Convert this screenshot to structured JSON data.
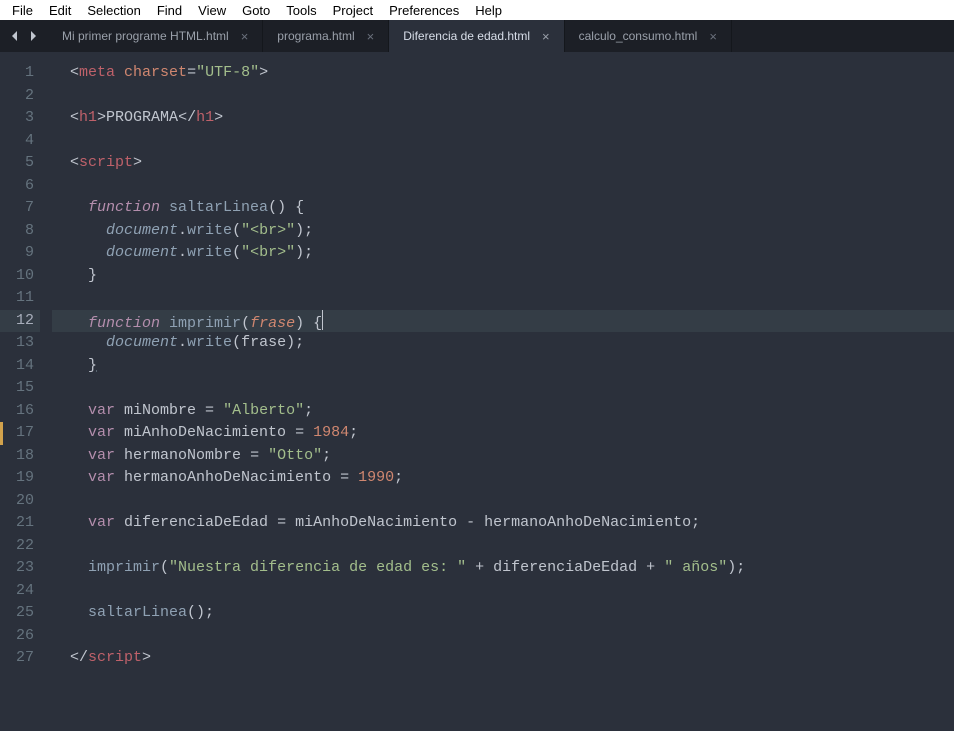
{
  "menu": {
    "items": [
      "File",
      "Edit",
      "Selection",
      "Find",
      "View",
      "Goto",
      "Tools",
      "Project",
      "Preferences",
      "Help"
    ]
  },
  "tabs": [
    {
      "label": "Mi primer programe HTML.html",
      "active": false
    },
    {
      "label": "programa.html",
      "active": false
    },
    {
      "label": "Diferencia de edad.html",
      "active": true
    },
    {
      "label": "calculo_consumo.html",
      "active": false
    }
  ],
  "current_line": 12,
  "modified_lines": [
    17
  ],
  "code": {
    "lines": [
      [
        {
          "t": "punct",
          "v": "<"
        },
        {
          "t": "tag",
          "v": "meta"
        },
        {
          "t": "plain",
          "v": " "
        },
        {
          "t": "attr",
          "v": "charset"
        },
        {
          "t": "punct",
          "v": "="
        },
        {
          "t": "string",
          "v": "\"UTF-8\""
        },
        {
          "t": "punct",
          "v": ">"
        }
      ],
      [],
      [
        {
          "t": "punct",
          "v": "<"
        },
        {
          "t": "tag",
          "v": "h1"
        },
        {
          "t": "punct",
          "v": ">"
        },
        {
          "t": "plain",
          "v": "PROGRAMA"
        },
        {
          "t": "punct",
          "v": "</"
        },
        {
          "t": "tag",
          "v": "h1"
        },
        {
          "t": "punct",
          "v": ">"
        }
      ],
      [],
      [
        {
          "t": "punct",
          "v": "<"
        },
        {
          "t": "tag",
          "v": "script"
        },
        {
          "t": "punct",
          "v": ">"
        }
      ],
      [],
      [
        {
          "t": "plain",
          "v": "  "
        },
        {
          "t": "kw",
          "v": "function"
        },
        {
          "t": "plain",
          "v": " "
        },
        {
          "t": "funcname",
          "v": "saltarLinea"
        },
        {
          "t": "punct",
          "v": "() {"
        }
      ],
      [
        {
          "t": "plain",
          "v": "    "
        },
        {
          "t": "obj",
          "v": "document"
        },
        {
          "t": "punct",
          "v": "."
        },
        {
          "t": "call",
          "v": "write"
        },
        {
          "t": "punct",
          "v": "("
        },
        {
          "t": "string",
          "v": "\"<br>\""
        },
        {
          "t": "punct",
          "v": ");"
        }
      ],
      [
        {
          "t": "plain",
          "v": "    "
        },
        {
          "t": "obj",
          "v": "document"
        },
        {
          "t": "punct",
          "v": "."
        },
        {
          "t": "call",
          "v": "write"
        },
        {
          "t": "punct",
          "v": "("
        },
        {
          "t": "string",
          "v": "\"<br>\""
        },
        {
          "t": "punct",
          "v": ");"
        }
      ],
      [
        {
          "t": "plain",
          "v": "  "
        },
        {
          "t": "punct",
          "v": "}"
        }
      ],
      [],
      [
        {
          "t": "plain",
          "v": "  "
        },
        {
          "t": "kw",
          "v": "function"
        },
        {
          "t": "plain",
          "v": " "
        },
        {
          "t": "funcname",
          "v": "imprimir"
        },
        {
          "t": "punct",
          "v": "("
        },
        {
          "t": "param",
          "v": "frase"
        },
        {
          "t": "punct",
          "v": ") {"
        },
        {
          "t": "cursor",
          "v": ""
        }
      ],
      [
        {
          "t": "plain",
          "v": "    "
        },
        {
          "t": "obj",
          "v": "document"
        },
        {
          "t": "punct",
          "v": "."
        },
        {
          "t": "call",
          "v": "write"
        },
        {
          "t": "punct",
          "v": "("
        },
        {
          "t": "plain",
          "v": "frase"
        },
        {
          "t": "punct",
          "v": ");"
        }
      ],
      [
        {
          "t": "plain",
          "v": "  "
        },
        {
          "t": "punct underline",
          "v": "}"
        }
      ],
      [],
      [
        {
          "t": "plain",
          "v": "  "
        },
        {
          "t": "storage",
          "v": "var"
        },
        {
          "t": "plain",
          "v": " miNombre "
        },
        {
          "t": "punct",
          "v": "="
        },
        {
          "t": "plain",
          "v": " "
        },
        {
          "t": "string",
          "v": "\"Alberto\""
        },
        {
          "t": "punct",
          "v": ";"
        }
      ],
      [
        {
          "t": "plain",
          "v": "  "
        },
        {
          "t": "storage",
          "v": "var"
        },
        {
          "t": "plain",
          "v": " miAnhoDeNacimiento "
        },
        {
          "t": "punct",
          "v": "="
        },
        {
          "t": "plain",
          "v": " "
        },
        {
          "t": "num",
          "v": "1984"
        },
        {
          "t": "punct",
          "v": ";"
        }
      ],
      [
        {
          "t": "plain",
          "v": "  "
        },
        {
          "t": "storage",
          "v": "var"
        },
        {
          "t": "plain",
          "v": " hermanoNombre "
        },
        {
          "t": "punct",
          "v": "="
        },
        {
          "t": "plain",
          "v": " "
        },
        {
          "t": "string",
          "v": "\"Otto\""
        },
        {
          "t": "punct",
          "v": ";"
        }
      ],
      [
        {
          "t": "plain",
          "v": "  "
        },
        {
          "t": "storage",
          "v": "var"
        },
        {
          "t": "plain",
          "v": " hermanoAnhoDeNacimiento "
        },
        {
          "t": "punct",
          "v": "="
        },
        {
          "t": "plain",
          "v": " "
        },
        {
          "t": "num",
          "v": "1990"
        },
        {
          "t": "punct",
          "v": ";"
        }
      ],
      [],
      [
        {
          "t": "plain",
          "v": "  "
        },
        {
          "t": "storage",
          "v": "var"
        },
        {
          "t": "plain",
          "v": " diferenciaDeEdad "
        },
        {
          "t": "punct",
          "v": "="
        },
        {
          "t": "plain",
          "v": " miAnhoDeNacimiento "
        },
        {
          "t": "punct",
          "v": "-"
        },
        {
          "t": "plain",
          "v": " hermanoAnhoDeNacimiento"
        },
        {
          "t": "punct",
          "v": ";"
        }
      ],
      [],
      [
        {
          "t": "plain",
          "v": "  "
        },
        {
          "t": "call",
          "v": "imprimir"
        },
        {
          "t": "punct",
          "v": "("
        },
        {
          "t": "string",
          "v": "\"Nuestra diferencia de edad es: \""
        },
        {
          "t": "plain",
          "v": " "
        },
        {
          "t": "punct",
          "v": "+"
        },
        {
          "t": "plain",
          "v": " diferenciaDeEdad "
        },
        {
          "t": "punct",
          "v": "+"
        },
        {
          "t": "plain",
          "v": " "
        },
        {
          "t": "string",
          "v": "\" años\""
        },
        {
          "t": "punct",
          "v": ");"
        }
      ],
      [],
      [
        {
          "t": "plain",
          "v": "  "
        },
        {
          "t": "call",
          "v": "saltarLinea"
        },
        {
          "t": "punct",
          "v": "();"
        }
      ],
      [],
      [
        {
          "t": "punct",
          "v": "</"
        },
        {
          "t": "tag",
          "v": "script"
        },
        {
          "t": "punct",
          "v": ">"
        }
      ]
    ]
  }
}
